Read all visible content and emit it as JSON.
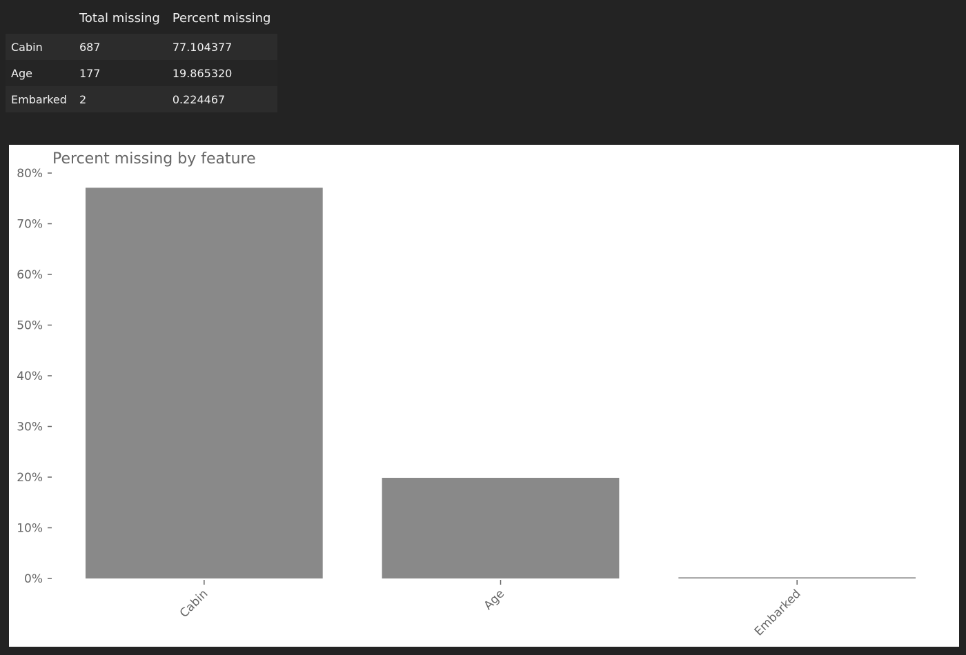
{
  "table": {
    "columns": [
      "",
      "Total missing",
      "Percent missing"
    ],
    "rows": [
      {
        "index": "Cabin",
        "total": "687",
        "percent": "77.104377"
      },
      {
        "index": "Age",
        "total": "177",
        "percent": "19.865320"
      },
      {
        "index": "Embarked",
        "total": "2",
        "percent": "0.224467"
      }
    ]
  },
  "chart_data": {
    "type": "bar",
    "title": "Percent missing by feature",
    "categories": [
      "Cabin",
      "Age",
      "Embarked"
    ],
    "values": [
      77.104377,
      19.86532,
      0.224467
    ],
    "ylim": [
      0,
      80
    ],
    "yticks": [
      "0%",
      "10%",
      "20%",
      "30%",
      "40%",
      "50%",
      "60%",
      "70%",
      "80%"
    ],
    "xlabel": "",
    "ylabel": "",
    "grid": false,
    "bar_color": "#898989",
    "text_color": "#666666"
  }
}
